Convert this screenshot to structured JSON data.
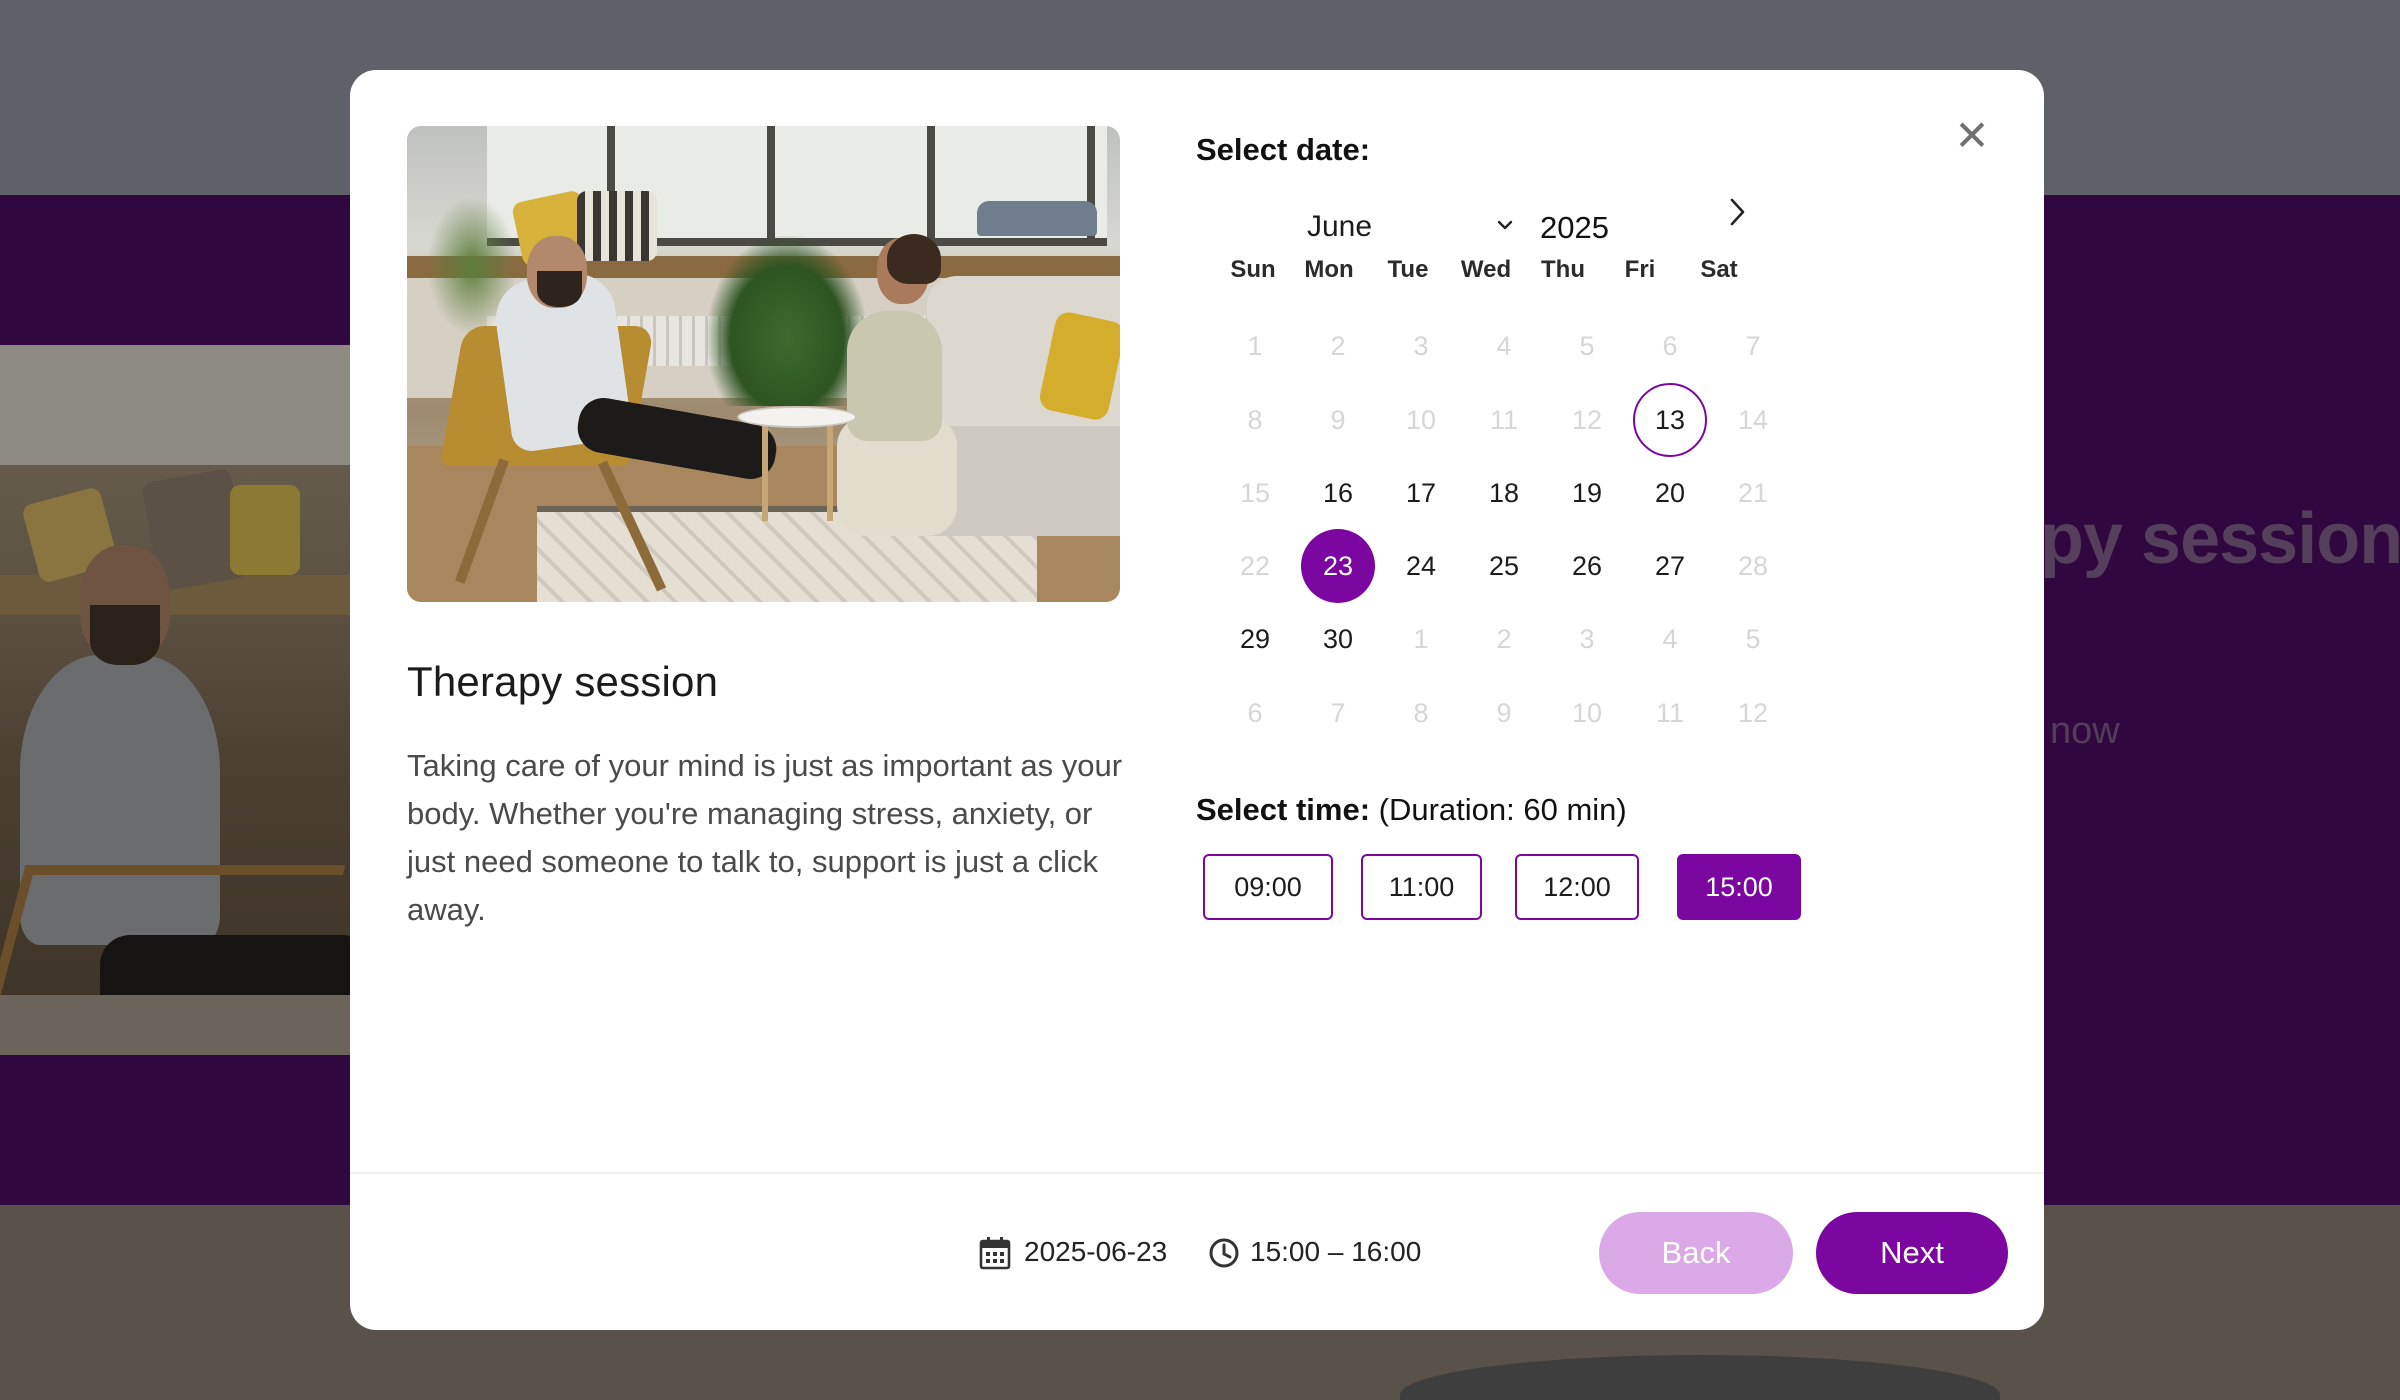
{
  "background": {
    "headline_fragment": "py session",
    "cta_fragment": "now"
  },
  "modal": {
    "close_icon": "close-icon",
    "service": {
      "title": "Therapy session",
      "description": "Taking care of your mind is just as important as your body. Whether you're managing stress, anxiety, or just need someone to talk to, support is just a click away."
    },
    "date_picker": {
      "label": "Select date:",
      "month": "June",
      "year": "2025",
      "next_icon": "chevron-right-icon",
      "weekdays": [
        "Sun",
        "Mon",
        "Tue",
        "Wed",
        "Thu",
        "Fri",
        "Sat"
      ],
      "weeks": [
        [
          "1",
          "2",
          "3",
          "4",
          "5",
          "6",
          "7"
        ],
        [
          "8",
          "9",
          "10",
          "11",
          "12",
          "13",
          "14"
        ],
        [
          "15",
          "16",
          "17",
          "18",
          "19",
          "20",
          "21"
        ],
        [
          "22",
          "23",
          "24",
          "25",
          "26",
          "27",
          "28"
        ],
        [
          "29",
          "30",
          "1",
          "2",
          "3",
          "4",
          "5"
        ],
        [
          "6",
          "7",
          "8",
          "9",
          "10",
          "11",
          "12"
        ]
      ],
      "today": "13",
      "selected": "23"
    },
    "time_picker": {
      "label": "Select time:",
      "duration": "(Duration: 60 min)",
      "slots": [
        "09:00",
        "11:00",
        "12:00",
        "15:00"
      ],
      "selected": "15:00"
    },
    "footer": {
      "summary_date": "2025-06-23",
      "summary_time": "15:00 – 16:00",
      "back_label": "Back",
      "next_label": "Next"
    }
  },
  "colors": {
    "accent": "#7b07a0",
    "accent_light": "#dba9e8",
    "muted_day": "#d6d6d6"
  }
}
